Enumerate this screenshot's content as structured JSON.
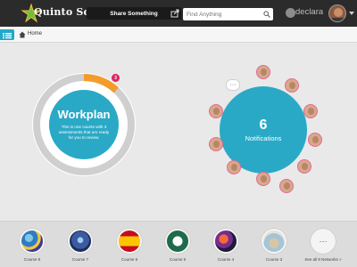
{
  "header": {
    "app_name": "Quinto Sol",
    "share_label": "Share Something",
    "search_placeholder": "Find Anything",
    "brand": "declara"
  },
  "breadcrumb": {
    "home_label": "Home"
  },
  "workplan": {
    "title": "Workplan",
    "description": "This is one course with 3 assessments that are ready for you to review.",
    "badge_count": "3",
    "progress_fraction": 0.12
  },
  "notifications": {
    "count": "6",
    "label": "Notifications",
    "more_label": "···"
  },
  "courses": [
    {
      "label": "Course 8"
    },
    {
      "label": "Course 7"
    },
    {
      "label": "Course 6"
    },
    {
      "label": "Course 5"
    },
    {
      "label": "Course 4"
    },
    {
      "label": "Course 3"
    },
    {
      "label": "See all 8 Networks »",
      "more_label": "···"
    }
  ],
  "colors": {
    "accent": "#2aa9c6",
    "progress": "#f39c2b",
    "badge": "#e0235e",
    "topbar": "#2b2b2b"
  }
}
